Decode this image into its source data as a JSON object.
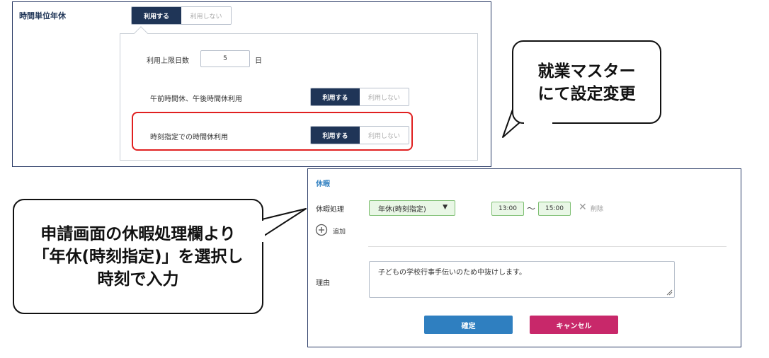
{
  "settings": {
    "section_label": "時間単位年休",
    "toggle_on": "利用する",
    "toggle_off": "利用しない",
    "limit_label": "利用上限日数",
    "limit_value": "5",
    "limit_unit": "日",
    "am_pm_label": "午前時間休、午後時間休利用",
    "time_spec_label": "時刻指定での時間休利用"
  },
  "callout_top": {
    "line1": "就業マスター",
    "line2": "にて設定変更"
  },
  "callout_left": {
    "line1": "申請画面の休暇処理欄より",
    "line2": "「年休(時刻指定)」を選択し",
    "line3": "時刻で入力"
  },
  "form": {
    "title": "休暇",
    "leave_label": "休暇処理",
    "leave_value": "年休(時刻指定)",
    "time_from": "13:00",
    "tilde": "〜",
    "time_to": "15:00",
    "delete_label": "削除",
    "add_label": "追加",
    "reason_label": "理由",
    "reason_value": "子どもの学校行事手伝いのため中抜けします。",
    "confirm_label": "確定",
    "cancel_label": "キャンセル"
  },
  "colors": {
    "navy": "#1f3557",
    "red_highlight": "#e02020",
    "confirm": "#2f7fc0",
    "cancel": "#c8286a",
    "green_bg": "#e9f7e6"
  }
}
